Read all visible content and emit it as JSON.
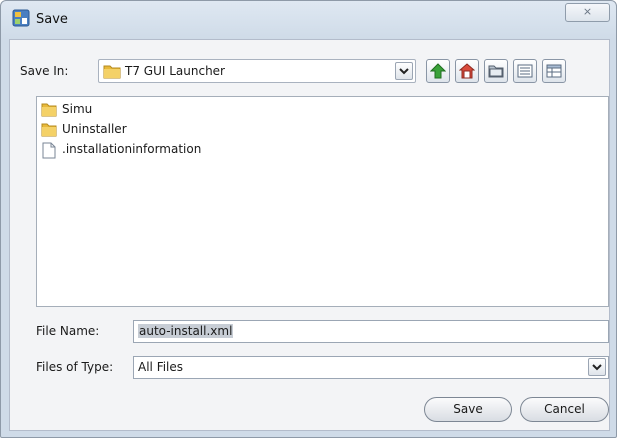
{
  "window": {
    "title": "Save",
    "close_glyph": "⨯"
  },
  "save_in": {
    "label": "Save In:",
    "value": "T7 GUI Launcher"
  },
  "toolbar": {
    "icons": [
      "up-folder-icon",
      "home-icon",
      "new-folder-icon",
      "list-view-icon",
      "details-view-icon"
    ]
  },
  "files": [
    {
      "name": "Simu",
      "icon": "folder-icon"
    },
    {
      "name": "Uninstaller",
      "icon": "folder-icon"
    },
    {
      "name": ".installationinformation",
      "icon": "file-icon"
    }
  ],
  "file_name": {
    "label": "File Name:",
    "value": "auto-install.xml"
  },
  "file_type": {
    "label": "Files of Type:",
    "value": "All Files"
  },
  "buttons": {
    "save": "Save",
    "cancel": "Cancel"
  },
  "colors": {
    "accent_green": "#3aa23a",
    "folder_yellow": "#e8b93a",
    "selection_gray": "#c7cdd5"
  }
}
